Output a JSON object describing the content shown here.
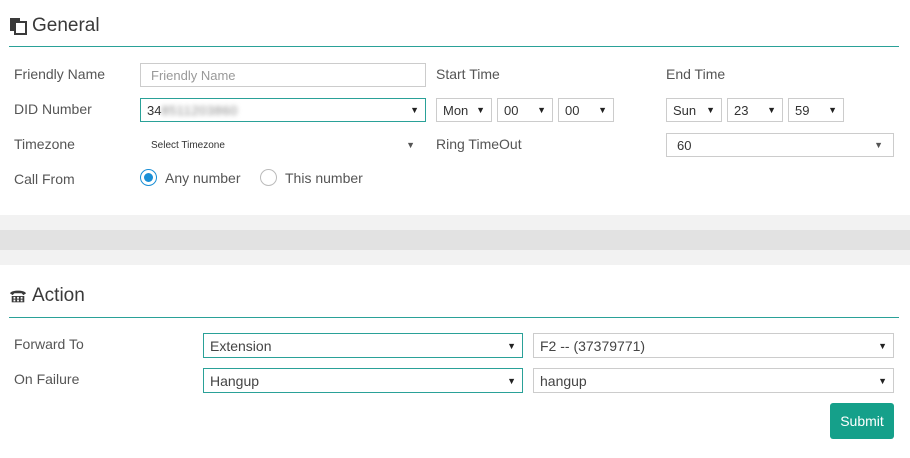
{
  "general": {
    "title": "General",
    "friendly_name": {
      "label": "Friendly Name",
      "placeholder": "Friendly Name"
    },
    "did_number": {
      "label": "DID Number",
      "value_visible": "34",
      "value_blurred": "8511203860"
    },
    "start_time": {
      "label": "Start Time",
      "day": "Mon",
      "hour": "00",
      "minute": "00"
    },
    "end_time": {
      "label": "End Time",
      "day": "Sun",
      "hour": "23",
      "minute": "59"
    },
    "timezone": {
      "label": "Timezone",
      "value": "Select Timezone"
    },
    "ring_timeout": {
      "label": "Ring TimeOut",
      "value": "60"
    },
    "call_from": {
      "label": "Call From",
      "options": [
        "Any number",
        "This number"
      ],
      "selected": "Any number"
    }
  },
  "action": {
    "title": "Action",
    "forward_to": {
      "label": "Forward To",
      "type": "Extension",
      "target": "F2 -- (37379771)"
    },
    "on_failure": {
      "label": "On Failure",
      "type": "Hangup",
      "target": "hangup"
    },
    "submit_label": "Submit"
  },
  "colors": {
    "accent": "#2aa198",
    "button": "#15a08a",
    "radio": "#1a8fd6"
  }
}
